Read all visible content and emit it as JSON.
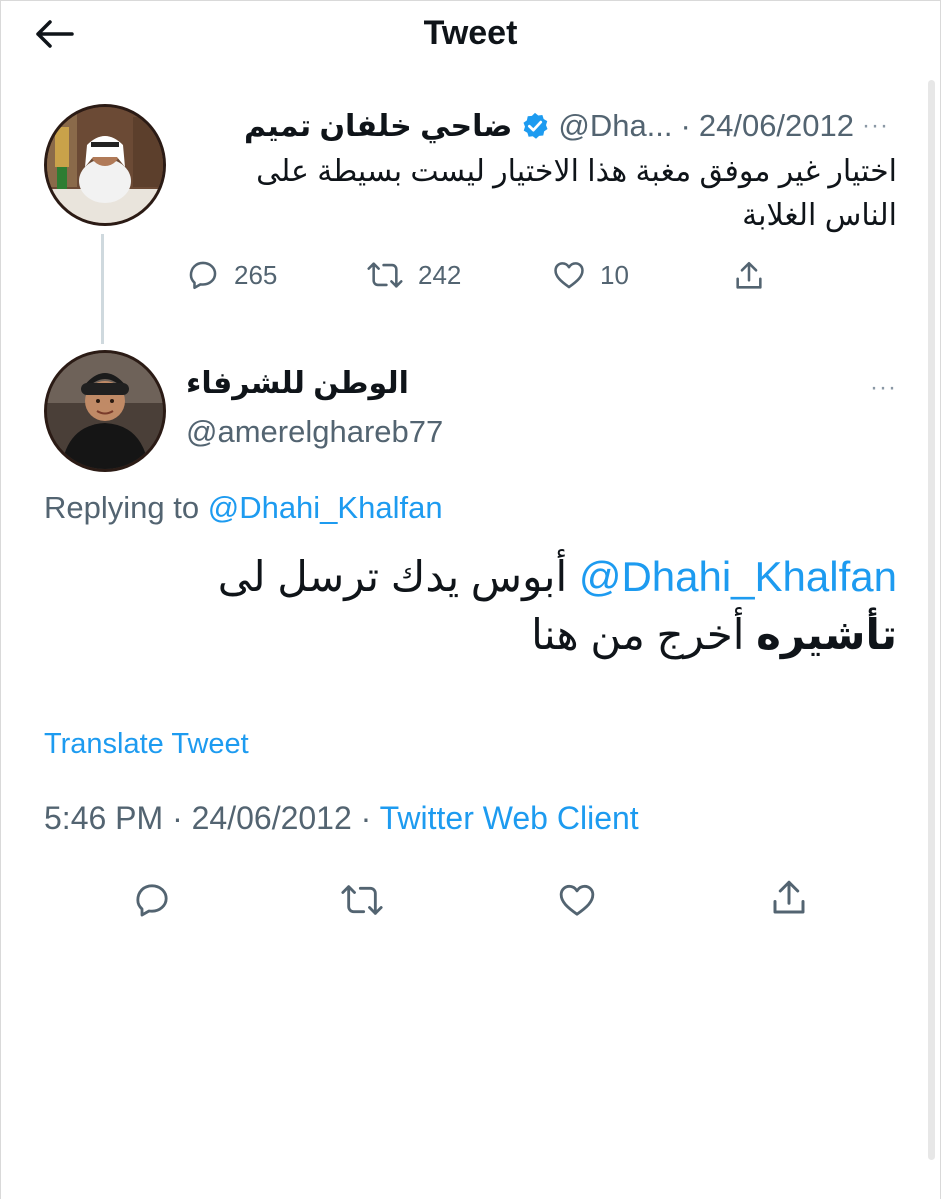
{
  "header": {
    "title": "Tweet",
    "back_icon": "arrow-left-icon"
  },
  "parent_tweet": {
    "display_name": "ضاحي خلفان تميم",
    "verified": true,
    "handle": "@Dha...",
    "separator": "·",
    "date": "24/06/2012",
    "more": "···",
    "text": "اختيار غير موفق مغبة هذا الاختيار ليست بسيطة على الناس الغلابة",
    "actions": {
      "reply_count": "265",
      "retweet_count": "242",
      "like_count": "10"
    }
  },
  "reply_tweet": {
    "display_name": "الوطن للشرفاء",
    "handle": "@amerelghareb77",
    "more": "···",
    "replying_prefix": "Replying to ",
    "replying_handle": "@Dhahi_Khalfan",
    "text_mention": "@Dhahi_Khalfan",
    "text_line1": " أبوس يدك ترسل لى",
    "text_bold": "تأشيره",
    "text_line2_rest": " أخرج من هنا",
    "translate_label": "Translate Tweet",
    "time": "5:46 PM",
    "sep": " · ",
    "date": "24/06/2012",
    "source": "Twitter Web Client"
  },
  "colors": {
    "link": "#1d9bf0",
    "secondary_text": "#536471",
    "primary_text": "#0f1419"
  }
}
